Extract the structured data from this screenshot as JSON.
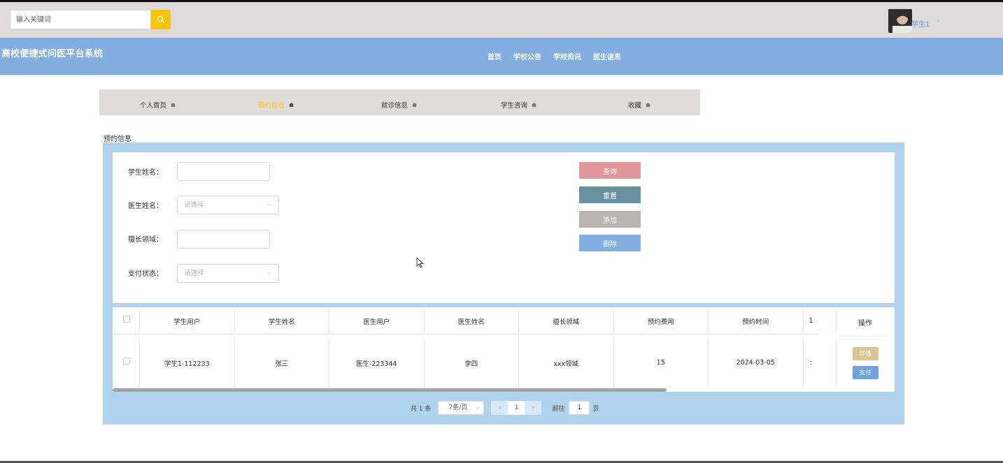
{
  "search": {
    "placeholder": "输入关键词"
  },
  "user": {
    "name": "学生1",
    "caret": "-"
  },
  "site_title": "高校便捷式问医平台系统",
  "nav": [
    "首页",
    "学校公告",
    "学校资讯",
    "医生信息"
  ],
  "subnav": [
    {
      "label": "个人首页",
      "active": false
    },
    {
      "label": "预约信息",
      "active": true
    },
    {
      "label": "就诊信息",
      "active": false
    },
    {
      "label": "学生咨询",
      "active": false
    },
    {
      "label": "收藏",
      "active": false
    }
  ],
  "section_label": "预约信息",
  "form": {
    "student_name_label": "学生姓名：",
    "doctor_name_label": "医生姓名：",
    "doctor_name_placeholder": "请选择",
    "field_label": "擅长领域：",
    "pay_status_label": "支付状态：",
    "pay_status_placeholder": "请选择"
  },
  "buttons": {
    "query": "查询",
    "reset": "重置",
    "add": "添加",
    "delete": "删除"
  },
  "colors": {
    "query": "#e0969b",
    "reset": "#6a8fa0",
    "add": "#b9b5b3",
    "delete": "#82aee0",
    "detail": "#dcc595",
    "pay": "#6fa3e0"
  },
  "table": {
    "headers": [
      "学生用户",
      "学生姓名",
      "医生用户",
      "医生姓名",
      "擅长领域",
      "预约费用",
      "预约时间",
      "1",
      "操作"
    ],
    "rows": [
      [
        "学生1-112233",
        "张三",
        "医生-223344",
        "李四",
        "xxx领域",
        "15",
        "2024-03-05",
        ":"
      ]
    ],
    "row_actions": {
      "detail": "详情",
      "pay": "支付"
    }
  },
  "pagination": {
    "total": "共 1 条",
    "page_size": "7条/页",
    "prev": "‹",
    "current": "1",
    "next": "›",
    "goto_label": "前往",
    "goto_value": "1",
    "page_suffix": "页"
  }
}
